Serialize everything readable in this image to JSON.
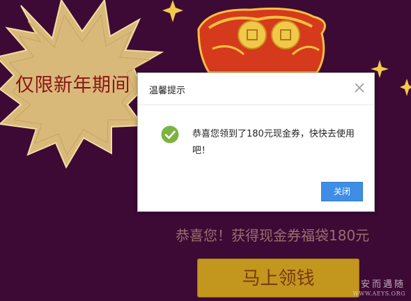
{
  "promo": {
    "banner_text": "仅限新年期间",
    "coupon_caption": "恭喜您！获得现金券福袋180元",
    "claim_button_label": "马上领钱"
  },
  "dialog": {
    "title": "温馨提示",
    "message": "恭喜您领到了180元现金券，快快去使用吧！",
    "ok_label": "关闭"
  },
  "watermark": {
    "name": "安而遇随",
    "url": "WWW.AEYS.ORG"
  },
  "colors": {
    "background": "#3d0a35",
    "button_gold": "#c3961e",
    "dialog_button": "#3e8ee5",
    "success_green": "#7cb342"
  },
  "icons": {
    "close": "close-icon",
    "success": "check-circle-icon",
    "sparkle": "star-sparkle-icon",
    "lucky_bag": "lucky-bag-icon",
    "burst": "starburst-badge"
  }
}
